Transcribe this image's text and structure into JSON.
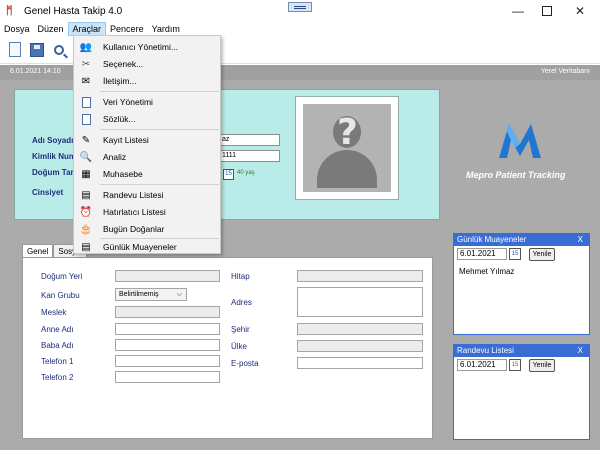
{
  "window": {
    "title": "Genel Hasta Takip 4.0"
  },
  "menubar": {
    "items": [
      "Dosya",
      "Düzen",
      "Araçlar",
      "Pencere",
      "Yardım"
    ]
  },
  "status": {
    "date_time": "6.01.2021 14:10",
    "database": "Yerel Veritabanı"
  },
  "patient": {
    "name_label": "Adı Soyadı",
    "id_label": "Kimlik Numarası",
    "birth_label": "Doğum Tarihi",
    "gender_label": "Cinsiyet",
    "name_value": "az",
    "id_value": "1111",
    "birth_value": "",
    "age_text": "40 yaş"
  },
  "logo": {
    "text": "Mepro Patient Tracking"
  },
  "tabs": [
    "Genel",
    "Sosyal"
  ],
  "form": {
    "birthplace": "Doğum Yeri",
    "blood_group": "Kan Grubu",
    "blood_value": "Belirtilmemiş",
    "job": "Meslek",
    "mother": "Anne Adı",
    "father": "Baba Adı",
    "phone1": "Telefon 1",
    "phone2": "Telefon 2",
    "address_title": "Hitap",
    "address": "Adres",
    "city": "Şehir",
    "country": "Ülke",
    "email": "E-posta"
  },
  "daily_panel": {
    "title": "Günlük Muayeneler",
    "close": "X",
    "date": "6.01.2021",
    "cal": "15",
    "refresh": "Yenile",
    "entries": [
      "Mehmet Yılmaz"
    ]
  },
  "appointment_panel": {
    "title": "Randevu Listesi",
    "close": "X",
    "date": "6.01.2021",
    "cal": "15",
    "refresh": "Yenile"
  },
  "tools_menu": {
    "users": "Kullanıcı Yönetimi...",
    "options": "Seçenek...",
    "contact": "İletişim...",
    "data_mgmt": "Veri Yönetimi",
    "dictionary": "Sözlük...",
    "records": "Kayıt Listesi",
    "analysis": "Analiz",
    "accounting": "Muhasebe",
    "appointments": "Randevu Listesi",
    "reminders": "Hatırlatıcı Listesi",
    "birthdays": "Bugün Doğanlar",
    "daily_exams": "Günlük Muayeneler"
  },
  "colors": {
    "accent": "#3a6dd4",
    "card": "#b9ece9",
    "label": "#1d2f7a",
    "background": "#ababab"
  }
}
